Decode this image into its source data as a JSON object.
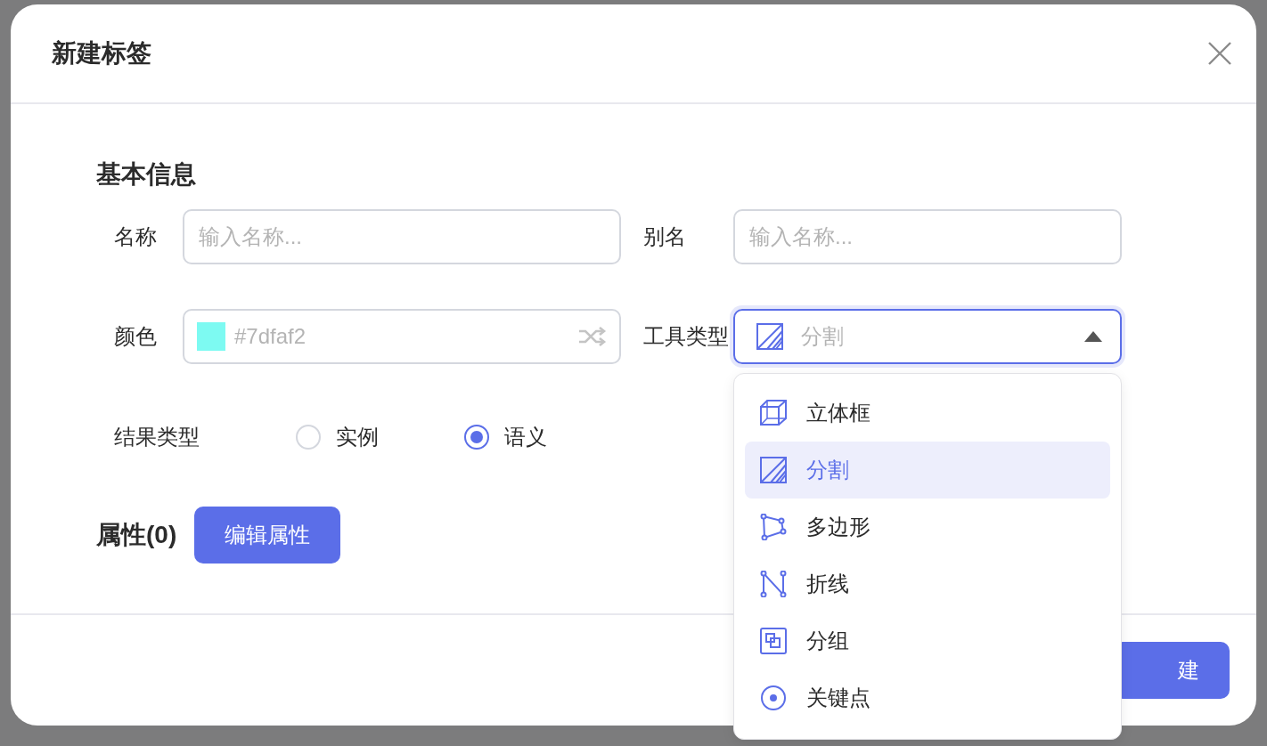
{
  "dialog": {
    "title": "新建标签"
  },
  "section_title": "基本信息",
  "fields": {
    "name": {
      "label": "名称",
      "placeholder": "输入名称..."
    },
    "alias": {
      "label": "别名",
      "placeholder": "输入名称..."
    },
    "color": {
      "label": "颜色",
      "placeholder": "#7dfaf2",
      "color": "#7dfaf2"
    },
    "tool_type": {
      "label": "工具类型",
      "value": "分割",
      "expanded": true
    }
  },
  "result_type": {
    "label": "结果类型",
    "options": [
      {
        "label": "实例",
        "selected": false
      },
      {
        "label": "语义",
        "selected": true
      }
    ]
  },
  "attributes": {
    "label": "属性(0)",
    "button": "编辑属性"
  },
  "footer_button": "建",
  "tool_options": [
    {
      "kind": "cuboid",
      "label": "立体框",
      "selected": false
    },
    {
      "kind": "segment",
      "label": "分割",
      "selected": true
    },
    {
      "kind": "polygon",
      "label": "多边形",
      "selected": false
    },
    {
      "kind": "polyline",
      "label": "折线",
      "selected": false
    },
    {
      "kind": "group",
      "label": "分组",
      "selected": false
    },
    {
      "kind": "keypoint",
      "label": "关键点",
      "selected": false
    }
  ]
}
